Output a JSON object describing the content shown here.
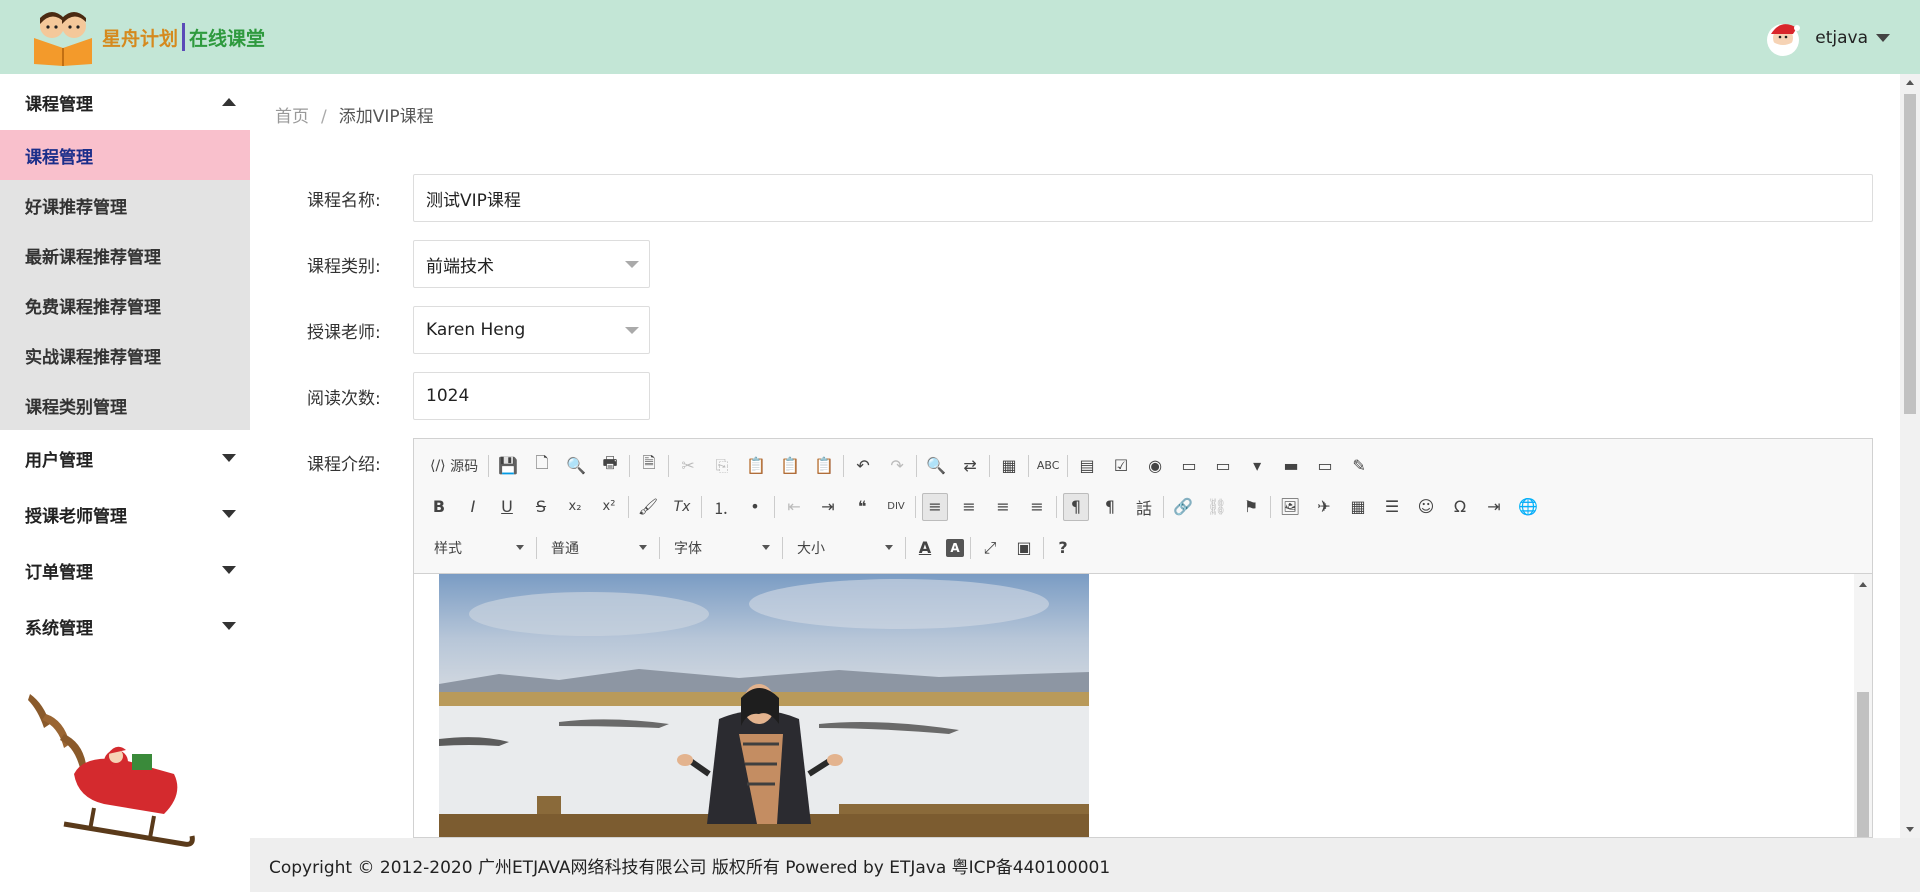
{
  "header": {
    "brand_a": "星舟计划",
    "brand_b": "在线课堂",
    "username": "etjava"
  },
  "sidebar": {
    "groups": [
      {
        "label": "课程管理",
        "expanded": true,
        "items": [
          "课程管理",
          "好课推荐管理",
          "最新课程推荐管理",
          "免费课程推荐管理",
          "实战课程推荐管理",
          "课程类别管理"
        ]
      },
      {
        "label": "用户管理",
        "expanded": false
      },
      {
        "label": "授课老师管理",
        "expanded": false
      },
      {
        "label": "订单管理",
        "expanded": false
      },
      {
        "label": "系统管理",
        "expanded": false
      }
    ]
  },
  "breadcrumb": {
    "home": "首页",
    "sep": "/",
    "current": "添加VIP课程"
  },
  "form": {
    "name_label": "课程名称:",
    "name_value": "测试VIP课程",
    "category_label": "课程类别:",
    "category_value": "前端技术",
    "teacher_label": "授课老师:",
    "teacher_value": "Karen Heng",
    "views_label": "阅读次数:",
    "views_value": "1024",
    "intro_label": "课程介绍:"
  },
  "editor": {
    "source_label": "源码",
    "style_combo": "样式",
    "format_combo": "普通",
    "font_combo": "字体",
    "size_combo": "大小",
    "row1": [
      "save",
      "new",
      "preview",
      "print",
      "templates",
      "cut",
      "copy",
      "paste",
      "paste-text",
      "paste-word",
      "undo",
      "redo",
      "find",
      "replace",
      "select-all",
      "spellcheck",
      "form",
      "checkbox",
      "radio",
      "textfield",
      "textarea",
      "select",
      "button",
      "imagebutton",
      "hiddenfield"
    ],
    "row1_glyphs": [
      "💾",
      "🗋",
      "🔍",
      "🖶",
      "🗎",
      "✂",
      "⎘",
      "📋",
      "📋",
      "📋",
      "↶",
      "↷",
      "🔍",
      "⇄",
      "▦",
      "ABC",
      "▤",
      "☑",
      "◉",
      "▭",
      "▭",
      "▾",
      "▬",
      "▭",
      "✎"
    ],
    "row2_glyphs": [
      "B",
      "I",
      "U",
      "S",
      "x₂",
      "x²",
      "🖌",
      "Tx",
      "⒈",
      "•",
      "⇤",
      "⇥",
      "❝",
      "DIV",
      "≡",
      "≡",
      "≡",
      "≡",
      "¶",
      "¶",
      "話",
      "🔗",
      "⛓",
      "⚑",
      "🖼",
      "✈",
      "▦",
      "☰",
      "☺",
      "Ω",
      "⇥",
      "🌐"
    ],
    "row3_glyphs": [
      "A",
      "A",
      "⤢",
      "▣",
      "?"
    ]
  },
  "footer": {
    "text": "Copyright © 2012-2020 广州ETJAVA网络科技有限公司 版权所有 Powered by ETJava 粤ICP备440100001"
  }
}
